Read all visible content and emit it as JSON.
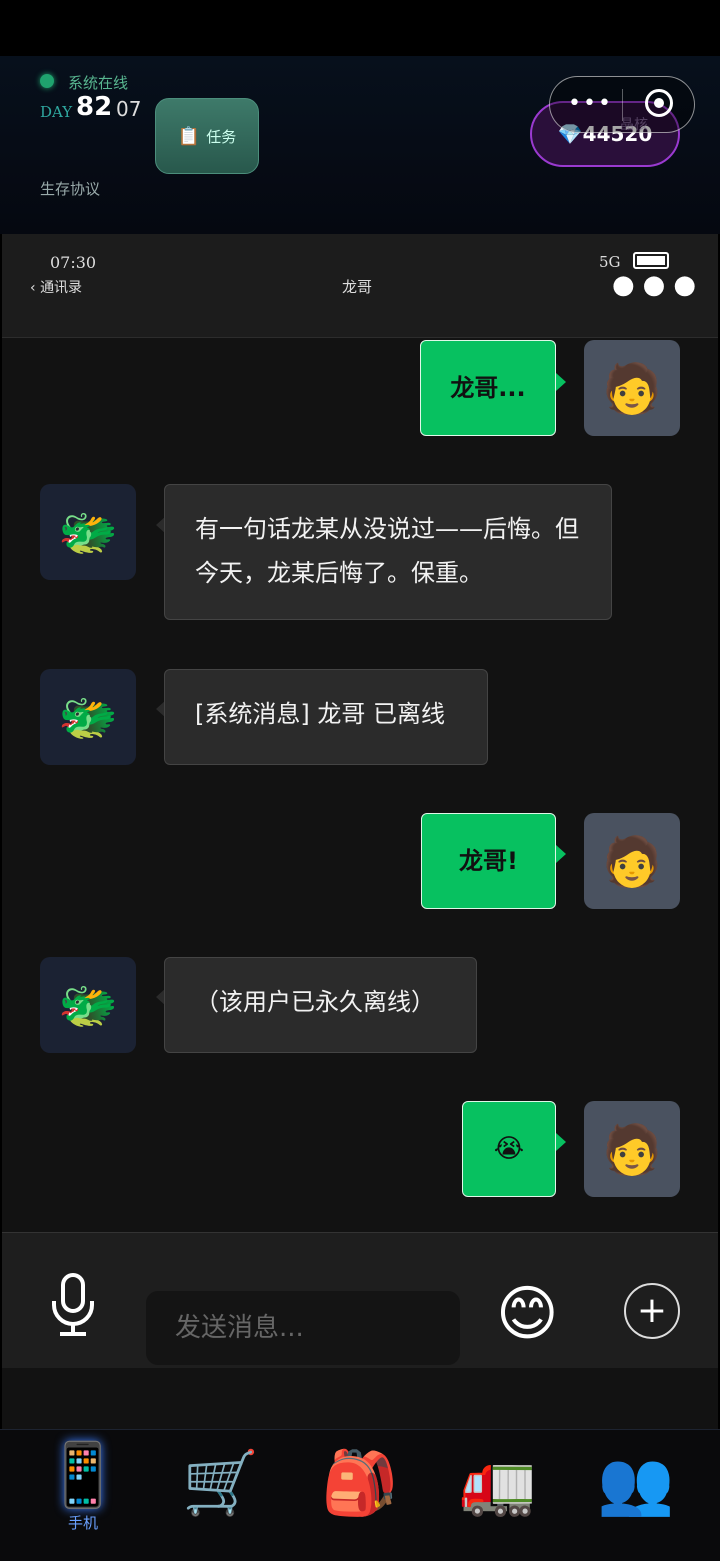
{
  "header": {
    "status_text": "系统在线",
    "day_label": "DAY",
    "day_number": "82",
    "day_sub": "07",
    "protocol_label": "生存协议",
    "task_label": "任务",
    "gem_value": "44520",
    "crystal_label": "晶核"
  },
  "phone": {
    "time": "07:30",
    "back_label": "通讯录",
    "chat_title": "龙哥",
    "signal": "5G"
  },
  "messages": [
    {
      "from": "me",
      "text": "龙哥..."
    },
    {
      "from": "dragon",
      "text": "有一句话龙某从没说过——后悔。但今天，龙某后悔了。保重。"
    },
    {
      "from": "dragon",
      "text": "[系统消息] 龙哥 已离线"
    },
    {
      "from": "me",
      "text": "龙哥!"
    },
    {
      "from": "dragon",
      "text": "（该用户已永久离线）"
    },
    {
      "from": "me",
      "text": "😭"
    }
  ],
  "composer": {
    "placeholder": "发送消息..."
  },
  "nav": {
    "items": [
      {
        "icon": "📱",
        "label": "手机",
        "active": true
      },
      {
        "icon": "🛒",
        "label": ""
      },
      {
        "icon": "🎒",
        "label": ""
      },
      {
        "icon": "🚛",
        "label": ""
      },
      {
        "icon": "👥",
        "label": ""
      }
    ]
  },
  "avatars": {
    "me": "🧑",
    "dragon": "🐲"
  },
  "colors": {
    "bubble_out": "#07c160",
    "bubble_in": "#2b2b2b",
    "accent": "#9a3ad0"
  }
}
